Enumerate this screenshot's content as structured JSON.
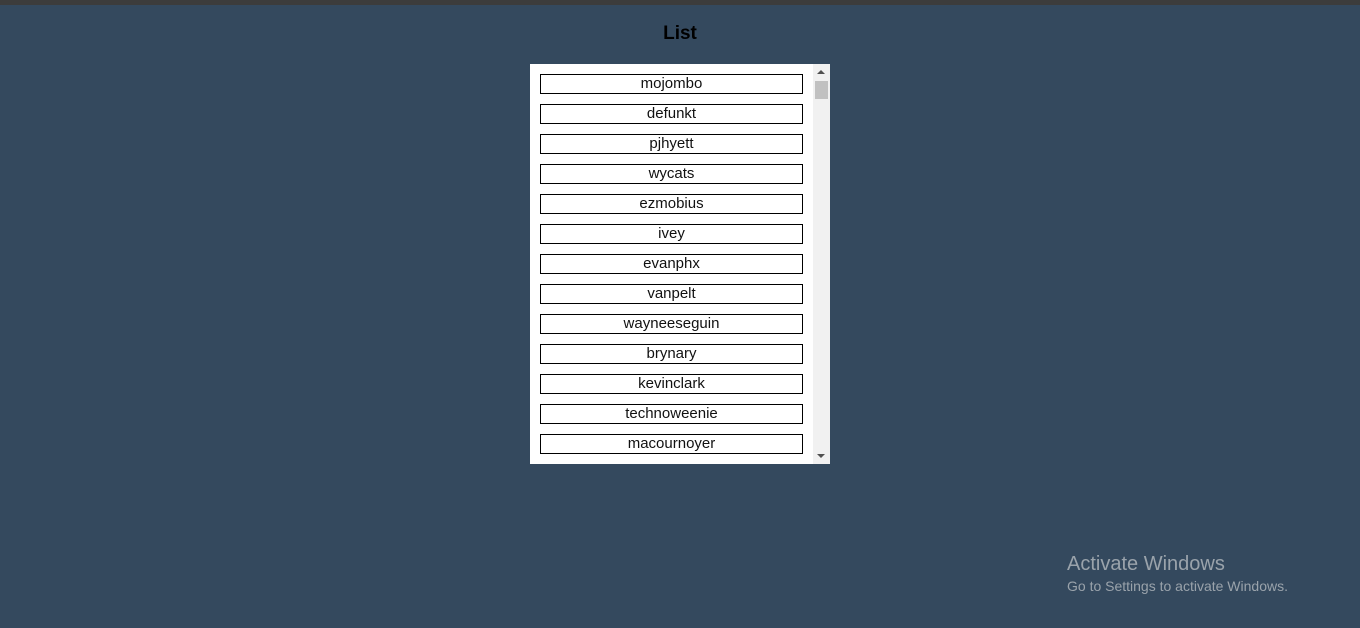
{
  "page": {
    "title": "List",
    "background_color": "#34495e"
  },
  "list": {
    "items": [
      "mojombo",
      "defunkt",
      "pjhyett",
      "wycats",
      "ezmobius",
      "ivey",
      "evanphx",
      "vanpelt",
      "wayneeseguin",
      "brynary",
      "kevinclark",
      "technoweenie",
      "macournoyer"
    ]
  },
  "scrollbar": {
    "up_icon": "chevron-up-icon",
    "down_icon": "chevron-down-icon"
  },
  "watermark": {
    "title": "Activate Windows",
    "subtitle": "Go to Settings to activate Windows."
  }
}
